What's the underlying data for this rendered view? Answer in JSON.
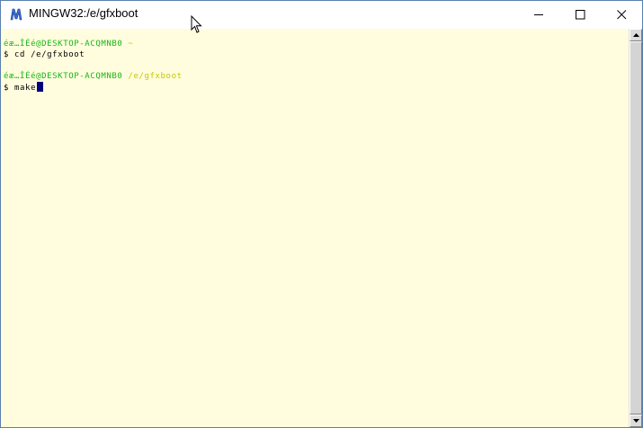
{
  "window": {
    "title": "MINGW32:/e/gfxboot",
    "app_icon": "mingw-m-icon",
    "controls": {
      "minimize": "minimize-icon",
      "maximize": "maximize-icon",
      "close": "close-icon"
    }
  },
  "terminal": {
    "background": "#fffddd",
    "prompt_color": "#17b617",
    "path_color": "#c6c600",
    "cursor_color": "#000080",
    "lines": [
      {
        "prompt": "éæ…ÎÉé@DESKTOP-ACQMNB0",
        "path": " ~"
      },
      {
        "command": "$ cd /e/gfxboot"
      },
      {
        "blank": ""
      },
      {
        "prompt": "éæ…ÎÉé@DESKTOP-ACQMNB0",
        "path": " /e/gfxboot"
      },
      {
        "command": "$ make"
      }
    ]
  },
  "scrollbar": {
    "up": "scroll-up-arrow-icon",
    "down": "scroll-down-arrow-icon"
  }
}
